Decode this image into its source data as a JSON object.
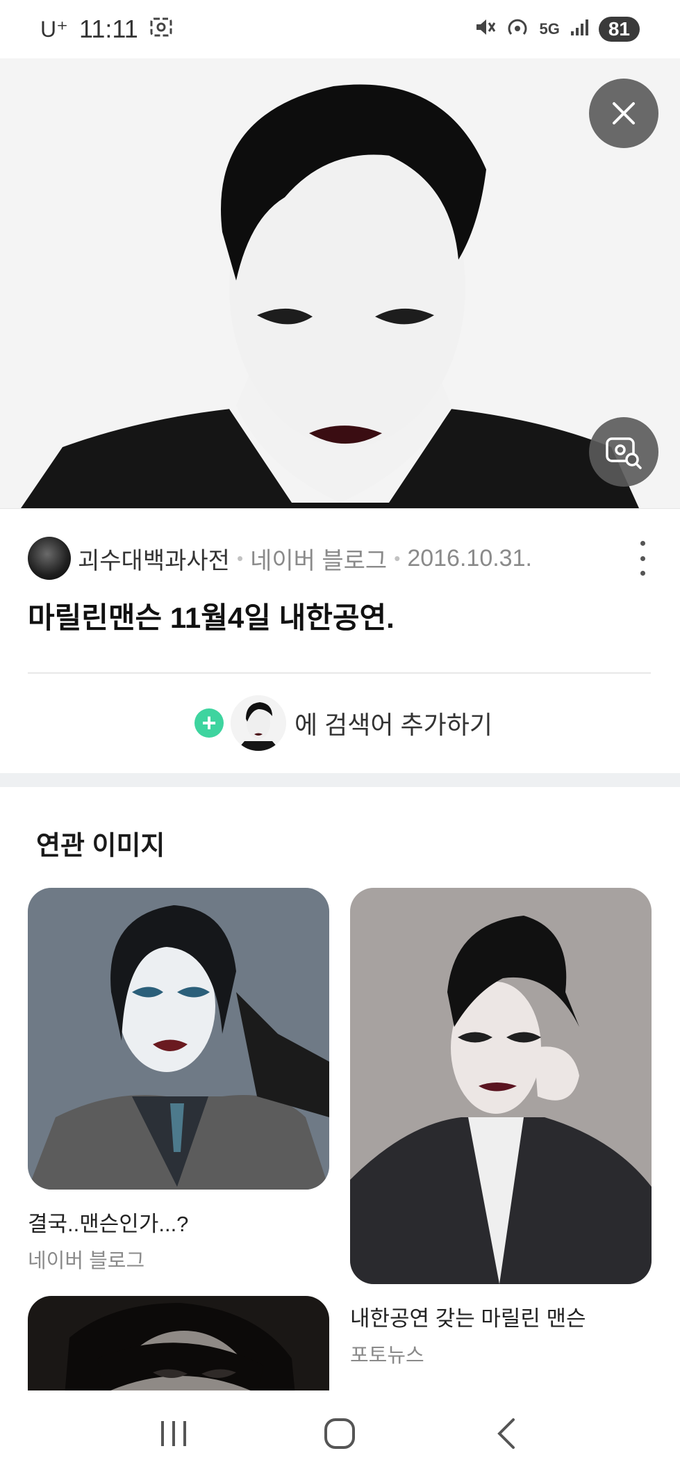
{
  "status_bar": {
    "carrier": "U⁺",
    "time": "11:11",
    "network": "5G",
    "battery": "81",
    "icons": [
      "screenshot-icon",
      "mute-icon",
      "hotspot-icon",
      "signal-icon"
    ]
  },
  "viewer": {
    "close_icon": "close-icon",
    "lens_icon": "image-search-icon"
  },
  "result": {
    "source_name": "괴수대백과사전",
    "platform": "네이버 블로그",
    "date": "2016.10.31.",
    "title": "마릴린맨슨 11월4일 내한공연.",
    "add_search_label": "에 검색어 추가하기"
  },
  "related": {
    "heading": "연관 이미지",
    "cards": [
      {
        "caption": "결국..맨슨인가...?",
        "source": "네이버 블로그"
      },
      {
        "caption": "내한공연 갖는 마릴린 맨슨",
        "source": "포토뉴스"
      }
    ]
  },
  "nav": {
    "recent_icon": "recent-apps-icon",
    "home_icon": "home-icon",
    "back_icon": "back-icon"
  }
}
